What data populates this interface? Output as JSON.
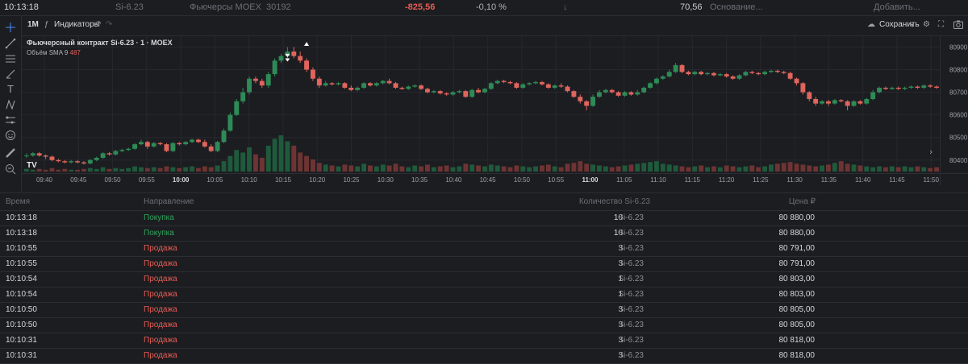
{
  "topbar": {
    "time": "10:13:18",
    "ticker": "Si-6.23",
    "market": "Фьючерсы MOEX",
    "price": "30192",
    "change": "-825,56",
    "change_pct": "-0,10 %",
    "arrow": "↓",
    "value": "70,56",
    "basis": "Основание...",
    "add": "Добавить..."
  },
  "toolbar": {
    "interval": "1M",
    "indicators": "Индикаторы",
    "save": "Сохранить"
  },
  "chart": {
    "title": "Фьючерсный контракт Si-6.23 · 1 · MOEX",
    "volume_label": "Объём SMA 9",
    "volume_value": "487",
    "wm": "TV"
  },
  "chart_data": {
    "type": "candlestick",
    "y_ticks": [
      "80900",
      "80800",
      "80700",
      "80600",
      "80500",
      "80400"
    ],
    "ylim": [
      80360,
      80930
    ],
    "x_ticks": [
      "09:40",
      "09:45",
      "09:50",
      "09:55",
      "10:00",
      "10:05",
      "10:10",
      "10:15",
      "10:20",
      "10:25",
      "10:30",
      "10:35",
      "10:40",
      "10:45",
      "10:50",
      "10:55",
      "11:00",
      "11:05",
      "11:10",
      "11:15",
      "11:20",
      "11:25",
      "11:30",
      "11:35",
      "11:40",
      "11:45",
      "11:50"
    ],
    "bold_ticks": [
      "10:00",
      "11:00"
    ],
    "up_color": "#2e8b57",
    "down_color": "#e0655d",
    "candles": [
      [
        80420,
        80420,
        80410,
        80430
      ],
      [
        80420,
        80430,
        80415,
        80435
      ],
      [
        80430,
        80420,
        80415,
        80435
      ],
      [
        80420,
        80415,
        80405,
        80425
      ],
      [
        80415,
        80400,
        80395,
        80420
      ],
      [
        80400,
        80395,
        80390,
        80405
      ],
      [
        80395,
        80390,
        80385,
        80400
      ],
      [
        80390,
        80395,
        80385,
        80400
      ],
      [
        80395,
        80390,
        80385,
        80400
      ],
      [
        80390,
        80385,
        80380,
        80395
      ],
      [
        80385,
        80400,
        80380,
        80405
      ],
      [
        80400,
        80410,
        80395,
        80415
      ],
      [
        80410,
        80430,
        80405,
        80435
      ],
      [
        80430,
        80425,
        80420,
        80435
      ],
      [
        80425,
        80440,
        80420,
        80445
      ],
      [
        80440,
        80445,
        80435,
        80450
      ],
      [
        80445,
        80450,
        80440,
        80455
      ],
      [
        80450,
        80470,
        80445,
        80475
      ],
      [
        80470,
        80480,
        80465,
        80490
      ],
      [
        80480,
        80460,
        80450,
        80485
      ],
      [
        80460,
        80475,
        80455,
        80480
      ],
      [
        80475,
        80470,
        80465,
        80480
      ],
      [
        80470,
        80440,
        80435,
        80475
      ],
      [
        80440,
        80475,
        80435,
        80480
      ],
      [
        80475,
        80470,
        80465,
        80480
      ],
      [
        80470,
        80480,
        80465,
        80485
      ],
      [
        80480,
        80490,
        80475,
        80495
      ],
      [
        80490,
        80480,
        80475,
        80495
      ],
      [
        80480,
        80460,
        80455,
        80490
      ],
      [
        80460,
        80440,
        80435,
        80470
      ],
      [
        80440,
        80480,
        80435,
        80485
      ],
      [
        80480,
        80530,
        80475,
        80540
      ],
      [
        80530,
        80600,
        80525,
        80610
      ],
      [
        80600,
        80660,
        80595,
        80670
      ],
      [
        80660,
        80700,
        80650,
        80720
      ],
      [
        80700,
        80760,
        80690,
        80770
      ],
      [
        80760,
        80750,
        80740,
        80770
      ],
      [
        80750,
        80730,
        80720,
        80760
      ],
      [
        80730,
        80780,
        80720,
        80790
      ],
      [
        80780,
        80840,
        80770,
        80850
      ],
      [
        80840,
        80860,
        80830,
        80870
      ],
      [
        80860,
        80880,
        80850,
        80900
      ],
      [
        80880,
        80860,
        80850,
        80900
      ],
      [
        80860,
        80840,
        80830,
        80880
      ],
      [
        80840,
        80800,
        80790,
        80850
      ],
      [
        80800,
        80760,
        80750,
        80810
      ],
      [
        80760,
        80730,
        80720,
        80770
      ],
      [
        80730,
        80740,
        80725,
        80750
      ],
      [
        80740,
        80735,
        80730,
        80745
      ],
      [
        80735,
        80740,
        80730,
        80745
      ],
      [
        80740,
        80720,
        80715,
        80745
      ],
      [
        80720,
        80710,
        80705,
        80730
      ],
      [
        80710,
        80720,
        80705,
        80725
      ],
      [
        80720,
        80740,
        80715,
        80745
      ],
      [
        80740,
        80730,
        80725,
        80745
      ],
      [
        80730,
        80740,
        80725,
        80745
      ],
      [
        80740,
        80750,
        80735,
        80755
      ],
      [
        80750,
        80740,
        80735,
        80760
      ],
      [
        80740,
        80720,
        80715,
        80745
      ],
      [
        80720,
        80715,
        80710,
        80725
      ],
      [
        80715,
        80725,
        80710,
        80730
      ],
      [
        80725,
        80730,
        80720,
        80735
      ],
      [
        80730,
        80715,
        80710,
        80735
      ],
      [
        80715,
        80700,
        80695,
        80720
      ],
      [
        80700,
        80705,
        80695,
        80710
      ],
      [
        80705,
        80695,
        80690,
        80710
      ],
      [
        80695,
        80690,
        80685,
        80700
      ],
      [
        80690,
        80700,
        80685,
        80705
      ],
      [
        80700,
        80705,
        80695,
        80710
      ],
      [
        80705,
        80680,
        80675,
        80710
      ],
      [
        80680,
        80710,
        80675,
        80715
      ],
      [
        80710,
        80700,
        80695,
        80720
      ],
      [
        80700,
        80715,
        80695,
        80720
      ],
      [
        80715,
        80740,
        80710,
        80745
      ],
      [
        80740,
        80750,
        80735,
        80755
      ],
      [
        80750,
        80745,
        80740,
        80755
      ],
      [
        80745,
        80740,
        80735,
        80750
      ],
      [
        80740,
        80720,
        80715,
        80745
      ],
      [
        80720,
        80735,
        80715,
        80740
      ],
      [
        80735,
        80740,
        80730,
        80745
      ],
      [
        80740,
        80745,
        80735,
        80750
      ],
      [
        80745,
        80735,
        80730,
        80750
      ],
      [
        80735,
        80720,
        80715,
        80740
      ],
      [
        80720,
        80730,
        80715,
        80735
      ],
      [
        80730,
        80725,
        80720,
        80740
      ],
      [
        80725,
        80705,
        80700,
        80730
      ],
      [
        80705,
        80680,
        80675,
        80710
      ],
      [
        80680,
        80660,
        80650,
        80690
      ],
      [
        80660,
        80640,
        80620,
        80665
      ],
      [
        80640,
        80680,
        80635,
        80690
      ],
      [
        80680,
        80700,
        80675,
        80710
      ],
      [
        80700,
        80710,
        80695,
        80715
      ],
      [
        80710,
        80700,
        80695,
        80715
      ],
      [
        80700,
        80685,
        80680,
        80705
      ],
      [
        80685,
        80700,
        80680,
        80705
      ],
      [
        80700,
        80690,
        80685,
        80705
      ],
      [
        80690,
        80700,
        80685,
        80710
      ],
      [
        80700,
        80720,
        80695,
        80725
      ],
      [
        80720,
        80740,
        80715,
        80745
      ],
      [
        80740,
        80760,
        80735,
        80765
      ],
      [
        80760,
        80770,
        80755,
        80775
      ],
      [
        80770,
        80790,
        80765,
        80800
      ],
      [
        80790,
        80820,
        80785,
        80830
      ],
      [
        80820,
        80790,
        80785,
        80825
      ],
      [
        80790,
        80780,
        80775,
        80795
      ],
      [
        80780,
        80790,
        80775,
        80795
      ],
      [
        80790,
        80780,
        80775,
        80795
      ],
      [
        80780,
        80785,
        80775,
        80790
      ],
      [
        80785,
        80775,
        80770,
        80790
      ],
      [
        80775,
        80780,
        80770,
        80785
      ],
      [
        80780,
        80770,
        80765,
        80785
      ],
      [
        80770,
        80760,
        80755,
        80775
      ],
      [
        80760,
        80775,
        80755,
        80780
      ],
      [
        80775,
        80790,
        80770,
        80795
      ],
      [
        80790,
        80785,
        80780,
        80795
      ],
      [
        80785,
        80780,
        80775,
        80790
      ],
      [
        80780,
        80790,
        80775,
        80795
      ],
      [
        80790,
        80795,
        80785,
        80800
      ],
      [
        80795,
        80790,
        80785,
        80800
      ],
      [
        80790,
        80785,
        80780,
        80795
      ],
      [
        80785,
        80760,
        80755,
        80790
      ],
      [
        80760,
        80740,
        80730,
        80765
      ],
      [
        80740,
        80700,
        80690,
        80745
      ],
      [
        80700,
        80670,
        80660,
        80705
      ],
      [
        80670,
        80650,
        80640,
        80680
      ],
      [
        80650,
        80660,
        80645,
        80665
      ],
      [
        80660,
        80650,
        80640,
        80665
      ],
      [
        80650,
        80665,
        80645,
        80670
      ],
      [
        80665,
        80660,
        80655,
        80670
      ],
      [
        80660,
        80640,
        80620,
        80665
      ],
      [
        80640,
        80660,
        80635,
        80665
      ],
      [
        80660,
        80650,
        80645,
        80665
      ],
      [
        80650,
        80670,
        80645,
        80675
      ],
      [
        80670,
        80700,
        80665,
        80710
      ],
      [
        80700,
        80720,
        80695,
        80725
      ],
      [
        80720,
        80715,
        80710,
        80725
      ],
      [
        80715,
        80720,
        80710,
        80725
      ],
      [
        80720,
        80715,
        80710,
        80725
      ],
      [
        80715,
        80720,
        80710,
        80725
      ],
      [
        80720,
        80725,
        80715,
        80730
      ],
      [
        80725,
        80720,
        80715,
        80730
      ],
      [
        80720,
        80730,
        80715,
        80735
      ],
      [
        80730,
        80725,
        80720,
        80735
      ],
      [
        80725,
        80720,
        80715,
        80730
      ]
    ],
    "volumes": [
      3,
      2,
      3,
      2,
      4,
      2,
      3,
      2,
      2,
      3,
      4,
      3,
      5,
      3,
      4,
      3,
      4,
      6,
      5,
      4,
      5,
      4,
      6,
      5,
      4,
      5,
      6,
      4,
      6,
      5,
      7,
      12,
      18,
      25,
      22,
      28,
      20,
      16,
      30,
      38,
      42,
      35,
      30,
      22,
      18,
      14,
      10,
      8,
      7,
      6,
      8,
      7,
      6,
      9,
      7,
      6,
      8,
      7,
      9,
      6,
      5,
      7,
      6,
      8,
      5,
      6,
      7,
      5,
      6,
      9,
      8,
      7,
      6,
      8,
      7,
      6,
      5,
      7,
      6,
      5,
      6,
      7,
      8,
      6,
      5,
      9,
      10,
      12,
      9,
      8,
      7,
      6,
      5,
      6,
      7,
      8,
      9,
      10,
      11,
      12,
      9,
      8,
      7,
      6,
      5,
      6,
      7,
      5,
      6,
      5,
      7,
      6,
      5,
      6,
      7,
      5,
      6,
      8,
      9,
      10,
      11,
      9,
      8,
      7,
      6,
      7,
      8,
      10,
      12,
      9,
      8,
      7,
      6,
      5,
      6,
      5,
      6,
      5,
      6,
      5,
      6,
      5,
      4,
      5,
      4,
      5
    ]
  },
  "trades": {
    "headers": {
      "time": "Время",
      "direction": "Направление",
      "qty": "Количество Si-6.23",
      "price": "Цена ₽"
    },
    "rows": [
      {
        "time": "10:13:18",
        "dir": "Покупка",
        "side": "buy",
        "qty": "10",
        "unit": "Si-6.23",
        "price": "80 880,00"
      },
      {
        "time": "10:13:18",
        "dir": "Покупка",
        "side": "buy",
        "qty": "10",
        "unit": "Si-6.23",
        "price": "80 880,00"
      },
      {
        "time": "10:10:55",
        "dir": "Продажа",
        "side": "sell",
        "qty": "3",
        "unit": "Si-6.23",
        "price": "80 791,00"
      },
      {
        "time": "10:10:55",
        "dir": "Продажа",
        "side": "sell",
        "qty": "3",
        "unit": "Si-6.23",
        "price": "80 791,00"
      },
      {
        "time": "10:10:54",
        "dir": "Продажа",
        "side": "sell",
        "qty": "1",
        "unit": "Si-6.23",
        "price": "80 803,00"
      },
      {
        "time": "10:10:54",
        "dir": "Продажа",
        "side": "sell",
        "qty": "1",
        "unit": "Si-6.23",
        "price": "80 803,00"
      },
      {
        "time": "10:10:50",
        "dir": "Продажа",
        "side": "sell",
        "qty": "3",
        "unit": "Si-6.23",
        "price": "80 805,00"
      },
      {
        "time": "10:10:50",
        "dir": "Продажа",
        "side": "sell",
        "qty": "3",
        "unit": "Si-6.23",
        "price": "80 805,00"
      },
      {
        "time": "10:10:31",
        "dir": "Продажа",
        "side": "sell",
        "qty": "3",
        "unit": "Si-6.23",
        "price": "80 818,00"
      },
      {
        "time": "10:10:31",
        "dir": "Продажа",
        "side": "sell",
        "qty": "3",
        "unit": "Si-6.23",
        "price": "80 818,00"
      }
    ]
  }
}
